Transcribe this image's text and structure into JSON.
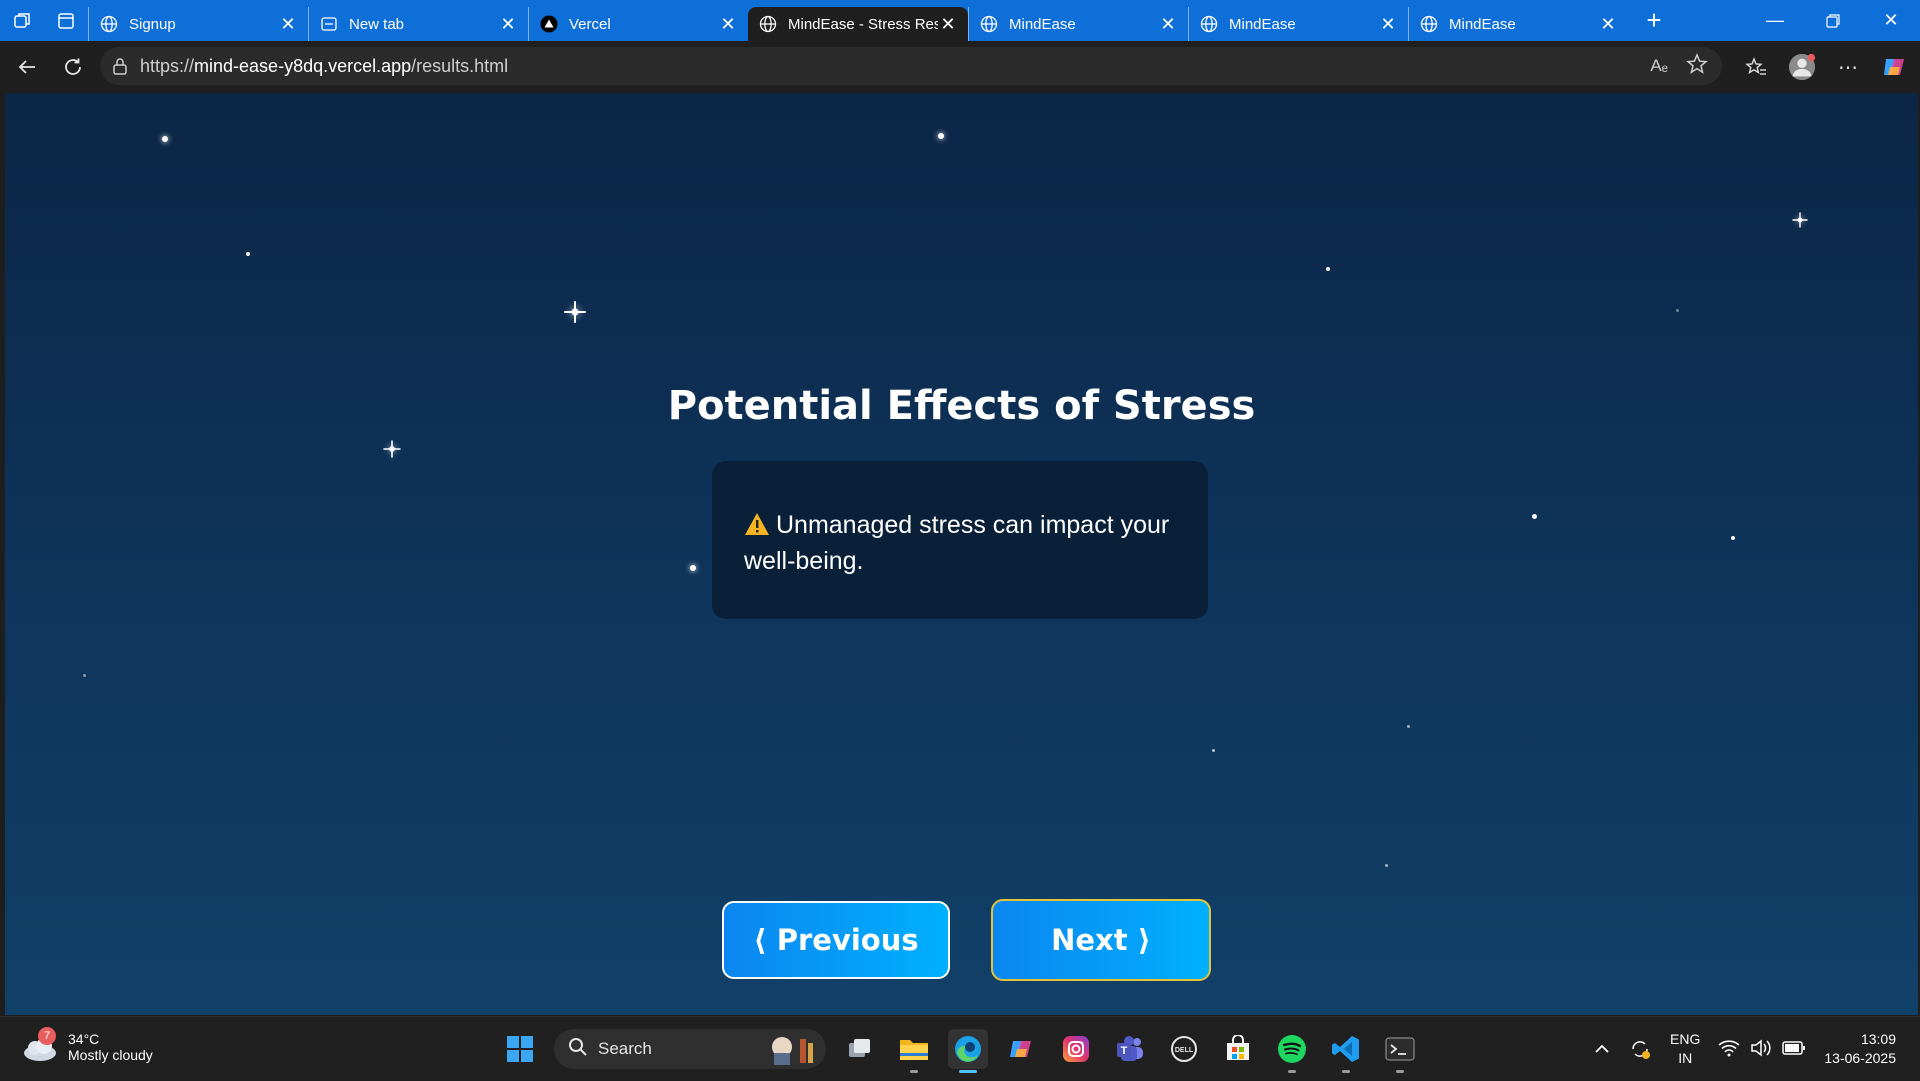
{
  "browser": {
    "tabs": [
      {
        "title": "Signup",
        "icon": "globe-icon"
      },
      {
        "title": "New tab",
        "icon": "newtab-icon"
      },
      {
        "title": "Vercel",
        "icon": "vercel-icon"
      },
      {
        "title": "MindEase - Stress Res",
        "icon": "globe-icon",
        "active": true
      },
      {
        "title": "MindEase",
        "icon": "globe-icon"
      },
      {
        "title": "MindEase",
        "icon": "globe-icon"
      },
      {
        "title": "MindEase",
        "icon": "globe-icon"
      }
    ],
    "url_prefix": "https://",
    "url_host": "mind-ease-y8dq.vercel.app",
    "url_path": "/results.html",
    "read_aloud_label": "Aₑ"
  },
  "page": {
    "title": "Potential Effects of Stress",
    "card_text": "Unmanaged stress can impact your well-being.",
    "prev_label": "⟨ Previous",
    "next_label": "Next ⟩",
    "colors": {
      "button": "#0b86f0",
      "next_border": "#e5c23c",
      "card": "#0a2039"
    }
  },
  "taskbar": {
    "weather_temp": "34°C",
    "weather_desc": "Mostly cloudy",
    "weather_badge": "7",
    "search_label": "Search",
    "lang_top": "ENG",
    "lang_bottom": "IN",
    "time": "13:09",
    "date": "13-06-2025"
  }
}
